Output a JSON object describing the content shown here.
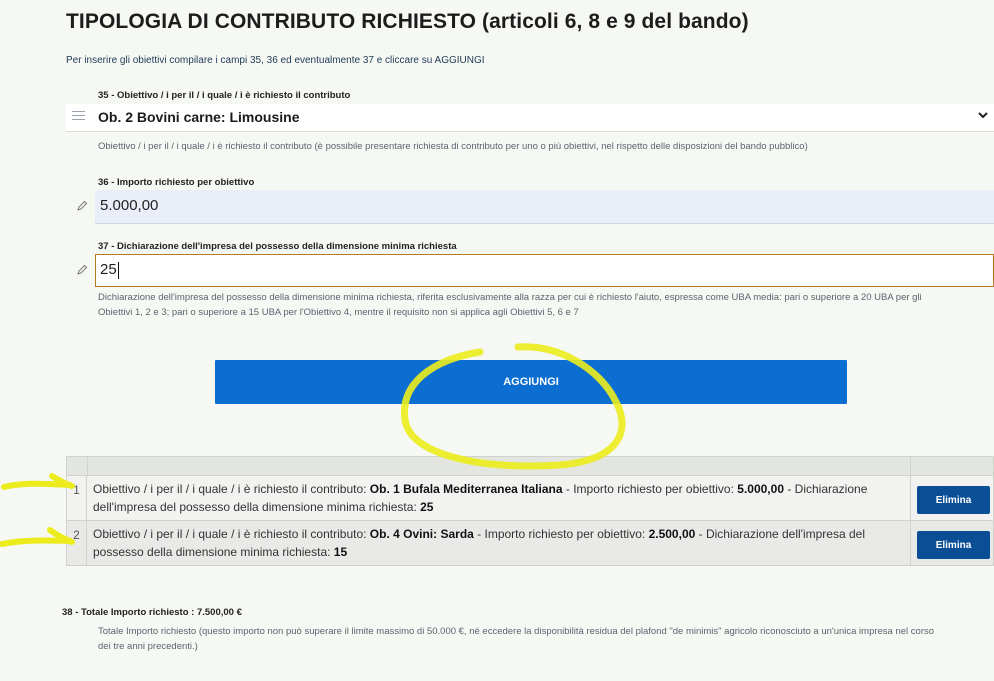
{
  "section": {
    "title": "TIPOLOGIA DI CONTRIBUTO RICHIESTO (articoli 6, 8 e 9 del bando)",
    "intro": "Per inserire gli obiettivi compilare i campi 35, 36 ed eventualmente 37 e cliccare su AGGIUNGI"
  },
  "field35": {
    "label": "35 - Obiettivo / i per il / i quale / i è richiesto il contributo",
    "value": "Ob. 2 Bovini carne: Limousine",
    "help": "Obiettivo / i per il / i quale / i è richiesto il contributo (è possibile presentare richiesta di contributo per uno o più obiettivi, nel rispetto delle disposizioni del bando pubblico)"
  },
  "field36": {
    "label": "36 - Importo richiesto per obiettivo",
    "value": "5.000,00"
  },
  "field37": {
    "label": "37 - Dichiarazione dell'impresa del possesso della dimensione minima richiesta",
    "value": "25",
    "help_line1": "Dichiarazione dell'impresa del possesso della dimensione minima richiesta, riferita esclusivamente alla razza per cui è richiesto l'aiuto, espressa come UBA media: pari o superiore a 20 UBA per gli",
    "help_line2": "Obiettivi 1, 2 e 3; pari o superiore a 15 UBA per l'Obiettivo 4, mentre il requisito non si applica agli Obiettivi 5, 6 e 7"
  },
  "add_button": "AGGIUNGI",
  "rows": [
    {
      "num": "1",
      "p1": "Obiettivo / i per il / i quale / i è richiesto il contributo: ",
      "obiettivo": "Ob. 1 Bufala Mediterranea Italiana",
      "p2": " - Importo richiesto per obiettivo: ",
      "importo": "5.000,00",
      "p3": " - Dichiarazione dell'impresa del possesso della dimensione minima richiesta: ",
      "dimensione": "25",
      "delete": "Elimina"
    },
    {
      "num": "2",
      "p1": "Obiettivo / i per il / i quale / i è richiesto il contributo: ",
      "obiettivo": "Ob. 4 Ovini: Sarda",
      "p2": " - Importo richiesto per obiettivo: ",
      "importo": "2.500,00",
      "p3": " - Dichiarazione dell'impresa del possesso della dimensione minima richiesta: ",
      "dimensione": "15",
      "delete": "Elimina"
    }
  ],
  "total": {
    "label": "38 - Totale Importo richiesto : 7.500,00 €",
    "help_line1": "Totale Importo richiesto (questo importo non può superare il limite massimo di 50.000 €, né eccedere la disponibilità residua del plafond \"de minimis\" agricolo riconosciuto a un'unica impresa nel corso",
    "help_line2": "dei tre anni precedenti.)"
  },
  "icons": {
    "select": "list-icon",
    "input": "pencil-icon",
    "dropdown": "chevron-down-icon"
  },
  "colors": {
    "primary_button": "#0d6ed1",
    "delete_button": "#0a4f96",
    "annotation": "#ecec1c"
  }
}
